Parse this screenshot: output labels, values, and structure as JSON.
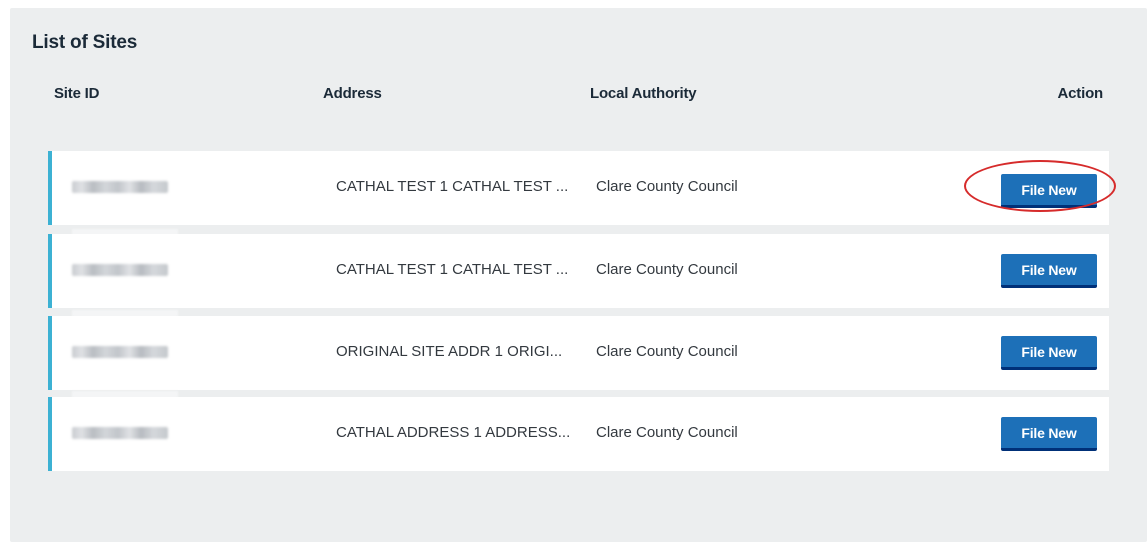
{
  "panel": {
    "title": "List of Sites"
  },
  "table": {
    "headers": {
      "site_id": "Site ID",
      "address": "Address",
      "local_authority": "Local Authority",
      "action": "Action"
    },
    "rows": [
      {
        "address": "CATHAL TEST 1 CATHAL TEST ...",
        "local_authority": "Clare County Council",
        "action_label": "File New"
      },
      {
        "address": "CATHAL TEST 1 CATHAL TEST ...",
        "local_authority": "Clare County Council",
        "action_label": "File New"
      },
      {
        "address": "ORIGINAL SITE ADDR 1 ORIGI...",
        "local_authority": "Clare County Council",
        "action_label": "File New"
      },
      {
        "address": "CATHAL ADDRESS 1 ADDRESS...",
        "local_authority": "Clare County Council",
        "action_label": "File New"
      }
    ]
  },
  "colors": {
    "panel_background": "#eceeef",
    "row_accent": "#3cb1d3",
    "button": "#1d70b8",
    "button_shadow": "#003078",
    "annotation_ring": "#d62b2b"
  }
}
